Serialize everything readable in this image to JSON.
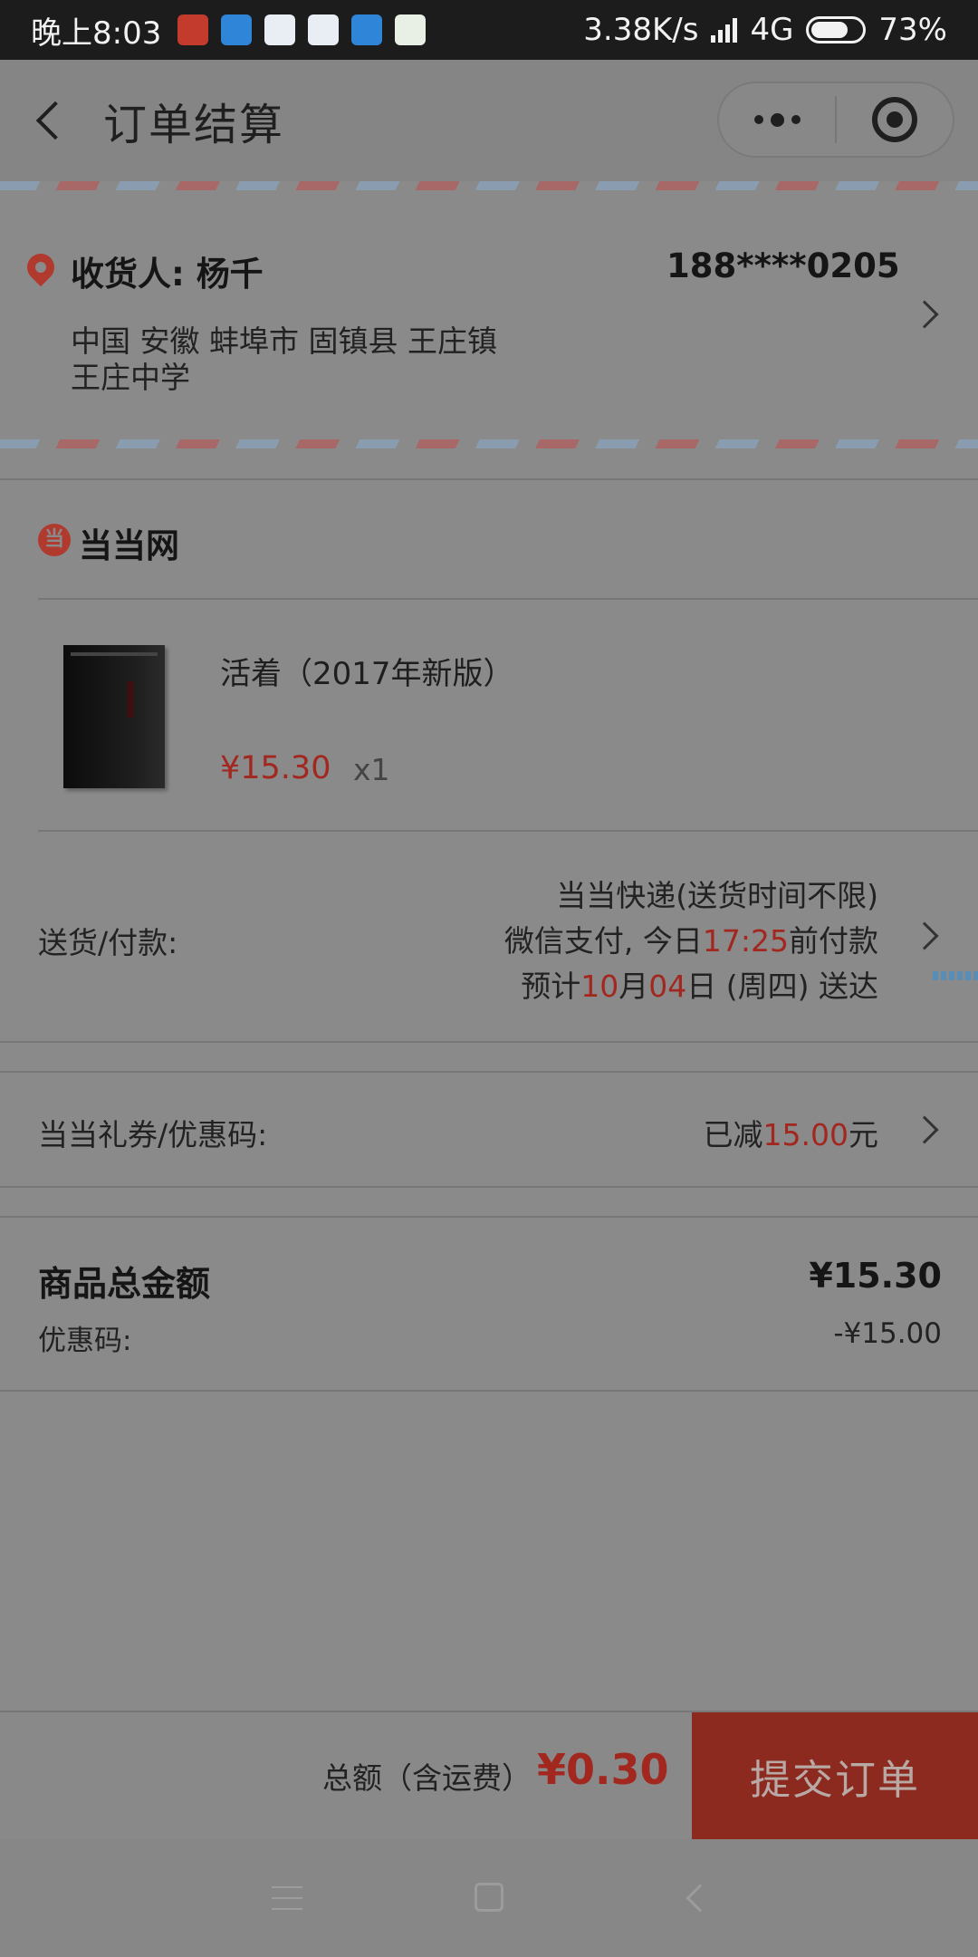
{
  "status_bar": {
    "time": "晚上8:03",
    "network_speed": "3.38K/s",
    "network_type": "4G",
    "battery_percent": "73%",
    "battery_level": 0.73,
    "notification_icons": [
      "gift-app-icon",
      "message-app-icon",
      "qq-app-icon",
      "qq-app-icon",
      "message-app-icon",
      "shop-app-icon"
    ]
  },
  "nav": {
    "title": "订单结算"
  },
  "address": {
    "recipient_label": "收货人:",
    "recipient_name": "杨千",
    "phone": "188****0205",
    "line1": "中国 安徽 蚌埠市 固镇县 王庄镇",
    "line2": "王庄中学"
  },
  "store": {
    "logo_text": "当",
    "name": "当当网"
  },
  "product": {
    "title": "活着（2017年新版）",
    "price": "¥15.30",
    "quantity": "x1"
  },
  "delivery": {
    "label": "送货/付款:",
    "line1": "当当快递(送货时间不限)",
    "line2_prefix": "微信支付, 今日",
    "line2_time": "17:25",
    "line2_suffix": "前付款",
    "line3_prefix": "预计",
    "line3_month": "10",
    "line3_mid": "月",
    "line3_day": "04",
    "line3_suffix": "日 (周四) 送达"
  },
  "coupon": {
    "label": "当当礼券/优惠码:",
    "value_prefix": "已减",
    "value_amount": "15.00",
    "value_suffix": "元"
  },
  "summary": {
    "total_label": "商品总金额",
    "total_value": "¥15.30",
    "discount_label": "优惠码:",
    "discount_value": "-¥15.00"
  },
  "bottom_bar": {
    "grand_total_label": "总额（含运费）",
    "grand_total_value": "¥0.30",
    "submit_label": "提交订单"
  },
  "colors": {
    "accent_red": "#a2271f",
    "submit_bg": "#8c2a1f",
    "overlay_gray": "#8a8a8a"
  }
}
